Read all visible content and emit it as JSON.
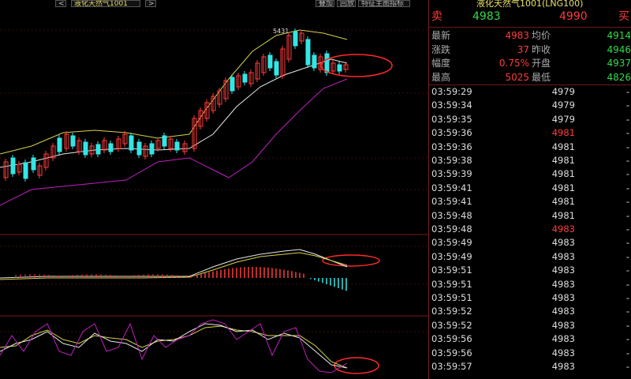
{
  "toolbar": {
    "prev_label": "<",
    "symbol_select_label": "液化天然气1001",
    "next_label": ">",
    "overlay_label": "叠加",
    "rewind_label": "回放",
    "indicator_label": "特征主图指标"
  },
  "header": {
    "title": "液化天然气1001(LNG100)"
  },
  "quote": {
    "sell_label": "卖",
    "sell_price": "4983",
    "buy_price": "4990",
    "buy_label": "买"
  },
  "stats": [
    {
      "l1": "最新",
      "v1": "4983",
      "l2": "均价",
      "v2": "4914",
      "c1": "red",
      "c2": "green"
    },
    {
      "l1": "涨跌",
      "v1": "37",
      "l2": "昨收",
      "v2": "4946",
      "c1": "red",
      "c2": "green"
    },
    {
      "l1": "幅度",
      "v1": "0.75%",
      "l2": "开盘",
      "v2": "4937",
      "c1": "red",
      "c2": "green"
    },
    {
      "l1": "最高",
      "v1": "5025",
      "l2": "最低",
      "v2": "4826",
      "c1": "red",
      "c2": "green"
    }
  ],
  "trades": [
    {
      "time": "03:59:29",
      "price": "4979",
      "vol": "-",
      "color": "white"
    },
    {
      "time": "03:59:34",
      "price": "4979",
      "vol": "-",
      "color": "white"
    },
    {
      "time": "03:59:35",
      "price": "4979",
      "vol": "-",
      "color": "white"
    },
    {
      "time": "03:59:36",
      "price": "4981",
      "vol": "-",
      "color": "red"
    },
    {
      "time": "03:59:36",
      "price": "4981",
      "vol": "-",
      "color": "white"
    },
    {
      "time": "03:59:38",
      "price": "4981",
      "vol": "-",
      "color": "white"
    },
    {
      "time": "03:59:39",
      "price": "4981",
      "vol": "-",
      "color": "white"
    },
    {
      "time": "03:59:41",
      "price": "4981",
      "vol": "-",
      "color": "white"
    },
    {
      "time": "03:59:41",
      "price": "4981",
      "vol": "-",
      "color": "white"
    },
    {
      "time": "03:59:48",
      "price": "4981",
      "vol": "-",
      "color": "white"
    },
    {
      "time": "03:59:48",
      "price": "4983",
      "vol": "-",
      "color": "red"
    },
    {
      "time": "03:59:49",
      "price": "4983",
      "vol": "-",
      "color": "white"
    },
    {
      "time": "03:59:49",
      "price": "4983",
      "vol": "-",
      "color": "white"
    },
    {
      "time": "03:59:51",
      "price": "4983",
      "vol": "-",
      "color": "white"
    },
    {
      "time": "03:59:51",
      "price": "4983",
      "vol": "-",
      "color": "white"
    },
    {
      "time": "03:59:51",
      "price": "4983",
      "vol": "-",
      "color": "white"
    },
    {
      "time": "03:59:52",
      "price": "4983",
      "vol": "-",
      "color": "white"
    },
    {
      "time": "03:59:52",
      "price": "4983",
      "vol": "-",
      "color": "white"
    },
    {
      "time": "03:59:56",
      "price": "4983",
      "vol": "-",
      "color": "white"
    },
    {
      "time": "03:59:56",
      "price": "4983",
      "vol": "-",
      "color": "white"
    },
    {
      "time": "03:59:57",
      "price": "4983",
      "vol": "-",
      "color": "white"
    }
  ],
  "chart_data": {
    "type": "candlestick",
    "annotations": [
      {
        "text": "5431"
      }
    ],
    "colors": {
      "up": "#ff3b3b",
      "down": "#33e6e6",
      "boll_upper": "#d6d24a",
      "boll_mid": "#e6e6e6",
      "boll_lower": "#c020c0",
      "highlight": "#ff2a2a"
    }
  }
}
